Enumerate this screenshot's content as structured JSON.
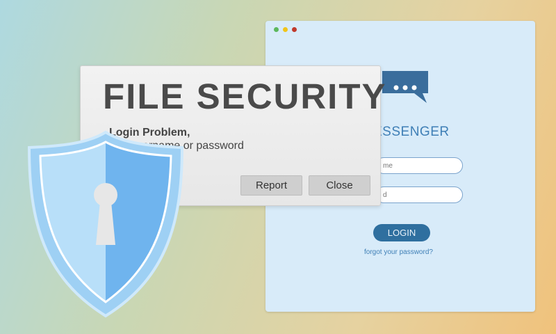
{
  "login_window": {
    "traffic_lights": [
      "#5cb85c",
      "#f0c419",
      "#c0392b"
    ],
    "chat_icon": "chat-bubble-icon",
    "app_name": "ESSENGER",
    "username_placeholder": "me",
    "password_placeholder": "d",
    "login_label": "LOGIN",
    "forgot_label": "forgot your password?"
  },
  "dialog": {
    "title": "FILE SECURITY",
    "message_heading": "Login Problem,",
    "message_body": "ong username or password",
    "report_label": "Report",
    "close_label": "Close"
  },
  "shield_icon": "keyhole-shield-icon",
  "colors": {
    "accent": "#2f6f9f",
    "window_bg": "#d8ebf9",
    "shield_light": "#a9d6f7",
    "shield_dark": "#6fb3ee"
  }
}
